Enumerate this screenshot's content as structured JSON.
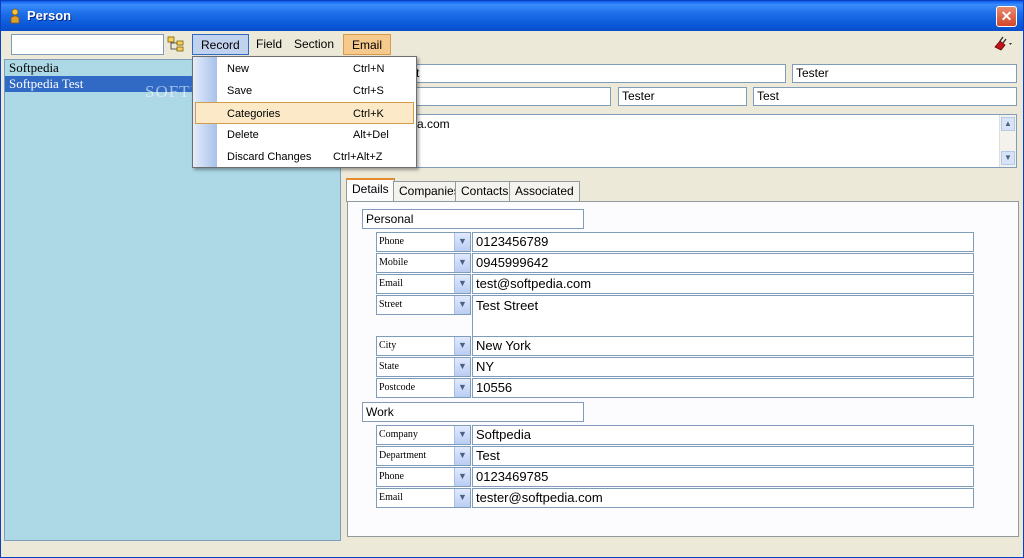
{
  "window": {
    "title": "Person",
    "close_glyph": "✕"
  },
  "toolbar": {
    "search_value": "",
    "tree_icon": "tree-view-icon",
    "menus": [
      {
        "label": "Record"
      },
      {
        "label": "Field"
      },
      {
        "label": "Section"
      },
      {
        "label": "Email"
      }
    ],
    "plug_icon": "plugin-icon"
  },
  "left_list": {
    "items": [
      {
        "label": "Softpedia"
      },
      {
        "label": "Softpedia Test"
      }
    ],
    "watermark": "SOFTPEDIA"
  },
  "header_fields": {
    "row1": {
      "a": "t",
      "b": "Tester"
    },
    "row2": {
      "a": "",
      "b": "Tester",
      "c": "Test"
    },
    "memo": "a.com"
  },
  "record_menu": {
    "items": [
      {
        "label": "New",
        "shortcut": "Ctrl+N"
      },
      {
        "label": "Save",
        "shortcut": "Ctrl+S"
      },
      {
        "label": "Categories",
        "shortcut": "Ctrl+K"
      },
      {
        "label": "Delete",
        "shortcut": "Alt+Del"
      },
      {
        "label": "Discard Changes",
        "shortcut": "Ctrl+Alt+Z"
      }
    ]
  },
  "tabs": [
    {
      "label": "Details"
    },
    {
      "label": "Companies"
    },
    {
      "label": "Contacts"
    },
    {
      "label": "Associated"
    }
  ],
  "personal": {
    "label": "Personal",
    "rows": [
      {
        "type": "Phone",
        "value": "0123456789"
      },
      {
        "type": "Mobile",
        "value": "0945999642"
      },
      {
        "type": "Email",
        "value": "test@softpedia.com"
      },
      {
        "type": "Street",
        "value": "Test Street"
      },
      {
        "type": "City",
        "value": "New York"
      },
      {
        "type": "State",
        "value": "NY"
      },
      {
        "type": "Postcode",
        "value": "10556"
      }
    ]
  },
  "work": {
    "label": "Work",
    "rows": [
      {
        "type": "Company",
        "value": "Softpedia"
      },
      {
        "type": "Department",
        "value": "Test"
      },
      {
        "type": "Phone",
        "value": "0123469785"
      },
      {
        "type": "Email",
        "value": "tester@softpedia.com"
      }
    ]
  },
  "colors": {
    "accent": "#316ac5",
    "list_bg": "#add8e6",
    "email_menu": "#f6c98d",
    "tab_highlight": "#e68b2c"
  }
}
